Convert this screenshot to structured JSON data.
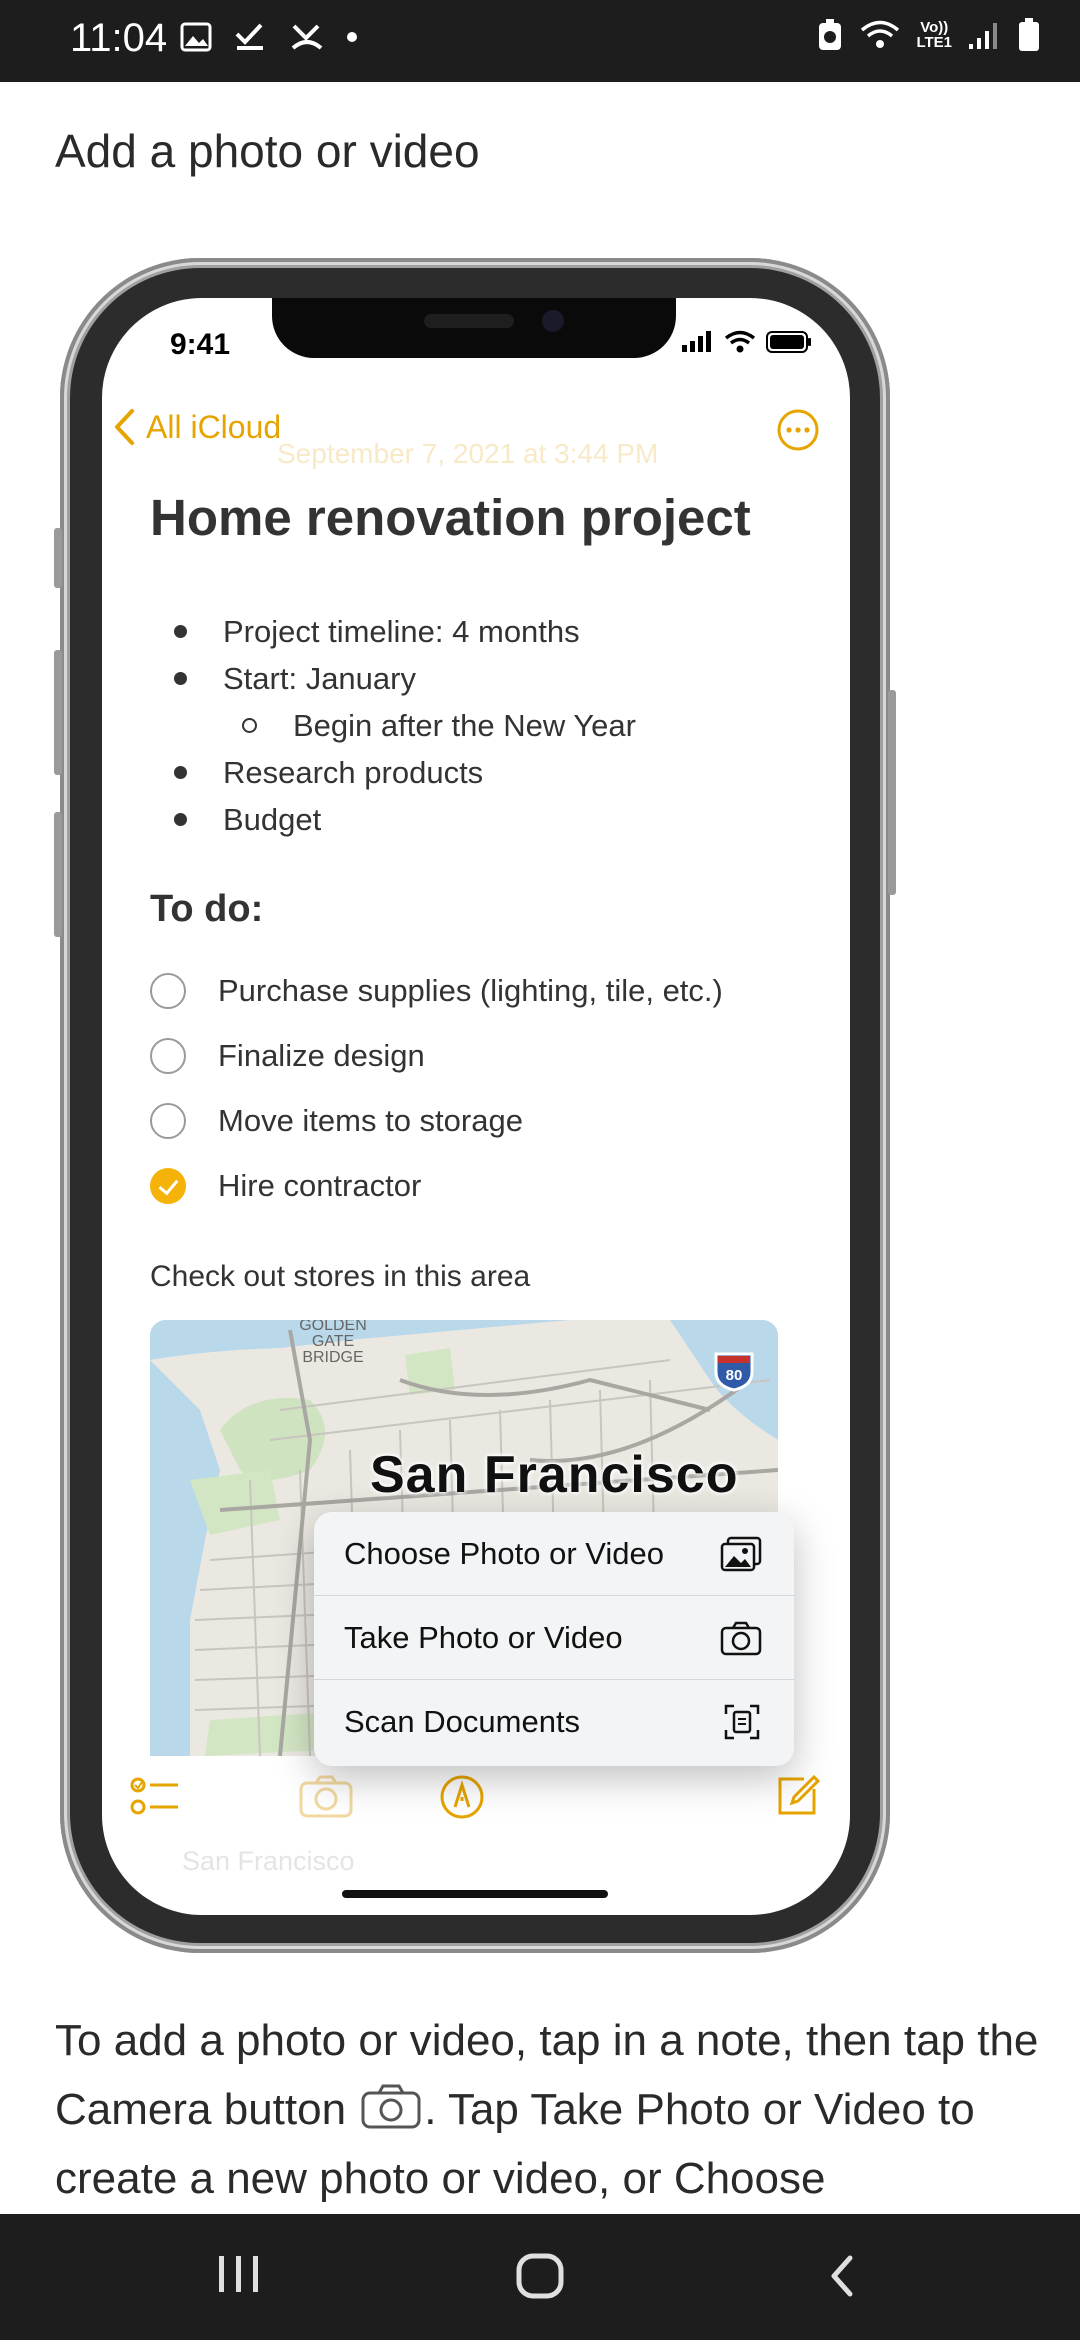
{
  "status_bar": {
    "time": "11:04",
    "network_label_top": "Vo))",
    "network_label_bottom": "LTE1"
  },
  "article": {
    "title": "Add a photo or video",
    "paragraph_before_icon": "To add a photo or video, tap in a note, then tap the Camera button",
    "paragraph_after_icon": ". Tap Take Photo or Video to create a new photo or video, or Choose"
  },
  "phone": {
    "time": "9:41",
    "back_label": "All iCloud",
    "faint_date": "September 7, 2021 at 3:44 PM",
    "note_title": "Home renovation project",
    "bullets": [
      {
        "text": "Project timeline: 4 months",
        "level": 1
      },
      {
        "text": "Start: January",
        "level": 1
      },
      {
        "text": "Begin after the New Year",
        "level": 2
      },
      {
        "text": "Research products",
        "level": 1
      },
      {
        "text": "Budget",
        "level": 1
      }
    ],
    "todo_heading": "To do:",
    "todos": [
      {
        "text": "Purchase supplies (lighting, tile, etc.)",
        "checked": false
      },
      {
        "text": "Finalize design",
        "checked": false
      },
      {
        "text": "Move items to storage",
        "checked": false
      },
      {
        "text": "Hire contractor",
        "checked": true
      }
    ],
    "area_text": "Check out stores in this area",
    "map": {
      "city_label": "San Francisco",
      "landmark": "GOLDEN GATE BRIDGE",
      "highway": "80"
    },
    "popup_menu": [
      {
        "label": "Choose Photo or Video",
        "icon": "photo-library-icon"
      },
      {
        "label": "Take Photo or Video",
        "icon": "camera-icon"
      },
      {
        "label": "Scan Documents",
        "icon": "scan-document-icon"
      }
    ],
    "faint_footer": "San Francisco",
    "accent_color": "#f5b30a"
  }
}
